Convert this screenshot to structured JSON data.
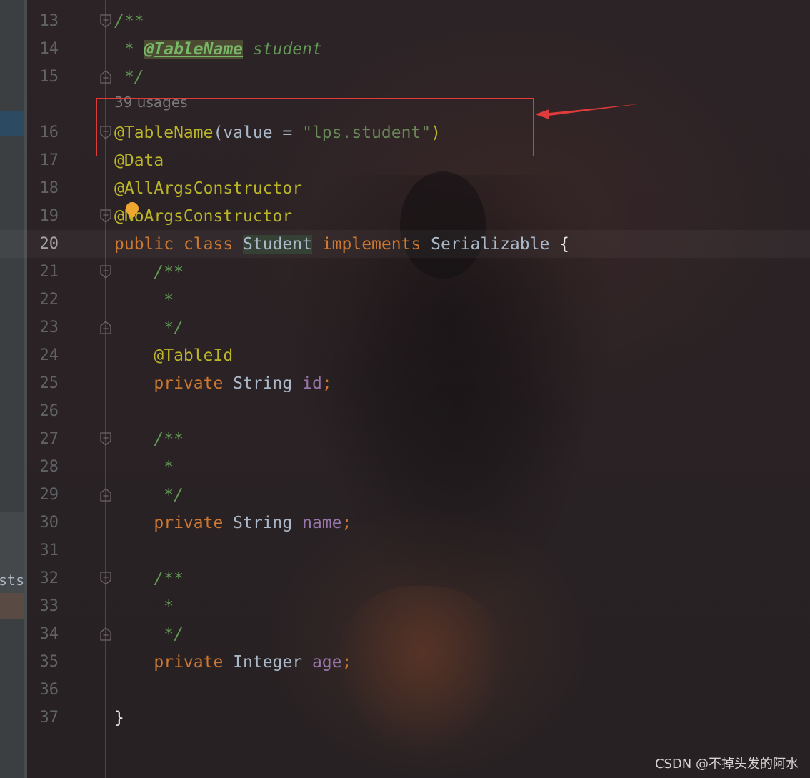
{
  "sidebar": {
    "clipped_text": "sts"
  },
  "editor": {
    "inlay_hint": "39 usages",
    "current_line": 20,
    "lines": [
      {
        "n": "13",
        "tokens": [
          {
            "t": "/**",
            "c": "com"
          }
        ]
      },
      {
        "n": "14",
        "tokens": [
          {
            "t": " * ",
            "c": "com"
          },
          {
            "t": "@TableName",
            "c": "tag"
          },
          {
            "t": " student",
            "c": "com"
          }
        ]
      },
      {
        "n": "15",
        "tokens": [
          {
            "t": " */",
            "c": "com"
          }
        ]
      },
      {
        "n": "16",
        "tokens": [
          {
            "t": "@TableName",
            "c": "ann"
          },
          {
            "t": "(value = ",
            "c": "cls"
          },
          {
            "t": "\"lps.student\"",
            "c": "str"
          },
          {
            "t": ")",
            "c": "ann"
          }
        ]
      },
      {
        "n": "17",
        "tokens": [
          {
            "t": "@Data",
            "c": "ann"
          }
        ]
      },
      {
        "n": "18",
        "tokens": [
          {
            "t": "@AllArgsConstructor",
            "c": "ann"
          }
        ]
      },
      {
        "n": "19",
        "tokens": [
          {
            "t": "@NoArgsConstructor",
            "c": "ann"
          }
        ]
      },
      {
        "n": "20",
        "tokens": [
          {
            "t": "public ",
            "c": "kw"
          },
          {
            "t": "class ",
            "c": "kw"
          },
          {
            "t": "Student",
            "c": "cls-hl"
          },
          {
            "t": " implements ",
            "c": "kw"
          },
          {
            "t": "Serializable ",
            "c": "cls"
          },
          {
            "t": "{",
            "c": "br"
          }
        ]
      },
      {
        "n": "21",
        "tokens": [
          {
            "t": "    /**",
            "c": "com"
          }
        ]
      },
      {
        "n": "22",
        "tokens": [
          {
            "t": "     *",
            "c": "com"
          }
        ]
      },
      {
        "n": "23",
        "tokens": [
          {
            "t": "     */",
            "c": "com"
          }
        ]
      },
      {
        "n": "24",
        "tokens": [
          {
            "t": "    @TableId",
            "c": "ann"
          }
        ]
      },
      {
        "n": "25",
        "tokens": [
          {
            "t": "    private ",
            "c": "kw"
          },
          {
            "t": "String ",
            "c": "cls"
          },
          {
            "t": "id",
            "c": "fld"
          },
          {
            "t": ";",
            "c": "kw"
          }
        ]
      },
      {
        "n": "26",
        "tokens": []
      },
      {
        "n": "27",
        "tokens": [
          {
            "t": "    /**",
            "c": "com"
          }
        ]
      },
      {
        "n": "28",
        "tokens": [
          {
            "t": "     *",
            "c": "com"
          }
        ]
      },
      {
        "n": "29",
        "tokens": [
          {
            "t": "     */",
            "c": "com"
          }
        ]
      },
      {
        "n": "30",
        "tokens": [
          {
            "t": "    private ",
            "c": "kw"
          },
          {
            "t": "String ",
            "c": "cls"
          },
          {
            "t": "name",
            "c": "fld"
          },
          {
            "t": ";",
            "c": "kw"
          }
        ]
      },
      {
        "n": "31",
        "tokens": []
      },
      {
        "n": "32",
        "tokens": [
          {
            "t": "    /**",
            "c": "com"
          }
        ]
      },
      {
        "n": "33",
        "tokens": [
          {
            "t": "     *",
            "c": "com"
          }
        ]
      },
      {
        "n": "34",
        "tokens": [
          {
            "t": "     */",
            "c": "com"
          }
        ]
      },
      {
        "n": "35",
        "tokens": [
          {
            "t": "    private ",
            "c": "kw"
          },
          {
            "t": "Integer ",
            "c": "cls"
          },
          {
            "t": "age",
            "c": "fld"
          },
          {
            "t": ";",
            "c": "kw"
          }
        ]
      },
      {
        "n": "36",
        "tokens": []
      },
      {
        "n": "37",
        "tokens": [
          {
            "t": "}",
            "c": "br"
          }
        ]
      }
    ]
  },
  "annotation": {
    "box_color": "#e03a3a"
  },
  "watermark": "CSDN @不掉头发的阿水"
}
